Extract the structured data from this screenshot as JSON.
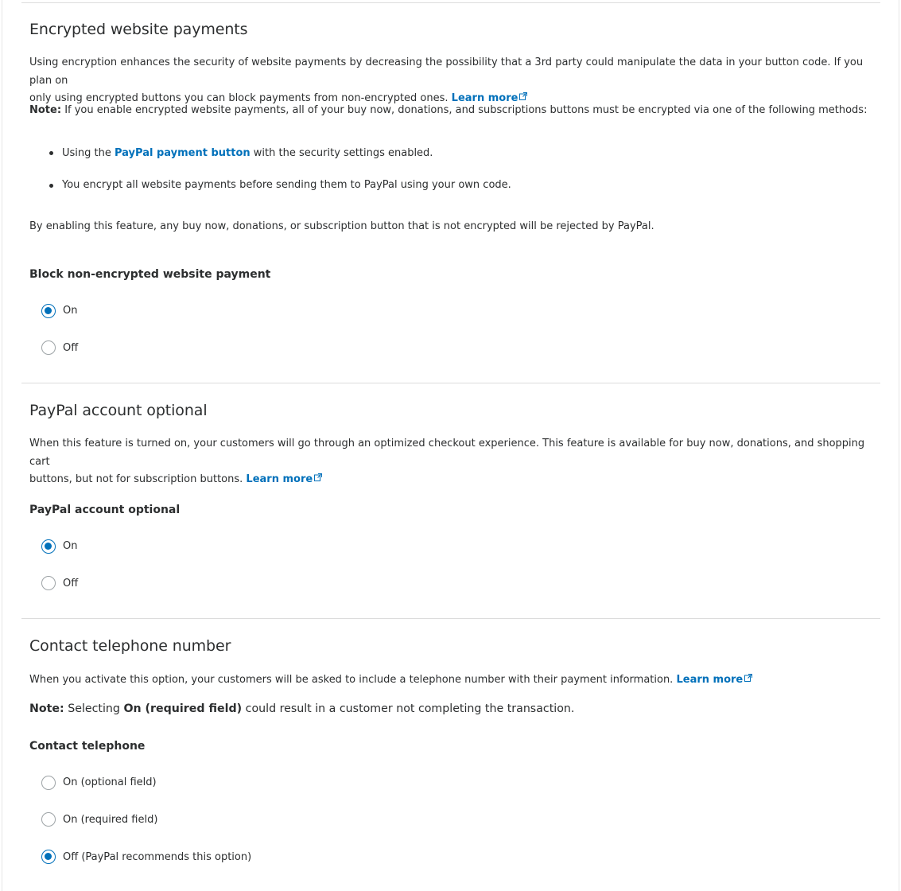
{
  "encrypted": {
    "title": "Encrypted website payments",
    "desc_line1": "Using encryption enhances the security of website payments by decreasing the possibility that a 3rd party could manipulate the data in your button code. If you plan on",
    "desc_line2": "only using encrypted buttons you can block payments from non-encrypted ones.",
    "learn_more": "Learn more",
    "note_label": "Note:",
    "note_text": "If you enable encrypted website payments, all of your buy now, donations, and subscriptions buttons must be encrypted via one of the following methods:",
    "bullet1_prefix": "Using the",
    "bullet1_link": "PayPal payment button",
    "bullet1_suffix": "with the security settings enabled.",
    "bullet2": "You encrypt all website payments before sending them to PayPal using your own code.",
    "enable_text": "By enabling this feature, any buy now, donations, or subscription button that is not encrypted will be rejected by PayPal.",
    "option_label": "Block non-encrypted website payment",
    "options": [
      "On",
      "Off"
    ],
    "selected": "On"
  },
  "account_optional": {
    "title": "PayPal account optional",
    "desc_line1": "When this feature is turned on, your customers will go through an optimized checkout experience. This feature is available for buy now, donations, and shopping cart",
    "desc_line2": "buttons, but not for subscription buttons.",
    "learn_more": "Learn more",
    "option_label": "PayPal account optional",
    "options": [
      "On",
      "Off"
    ],
    "selected": "On"
  },
  "telephone": {
    "title": "Contact telephone number",
    "desc": "When you activate this option, your customers will be asked to include a telephone number with their payment information.",
    "learn_more": "Learn more",
    "note_label": "Note:",
    "note_pre": "Selecting",
    "note_bold": "On (required field)",
    "note_post": "could result in a customer not completing the transaction.",
    "option_label": "Contact telephone",
    "options": [
      "On (optional field)",
      "On (required field)",
      "Off (PayPal recommends this option)"
    ],
    "selected": "Off (PayPal recommends this option)"
  },
  "colors": {
    "link": "#0070ba",
    "text": "#2c2e2f",
    "divider": "#dcdcdc",
    "radio_border": "#9da3a6"
  }
}
